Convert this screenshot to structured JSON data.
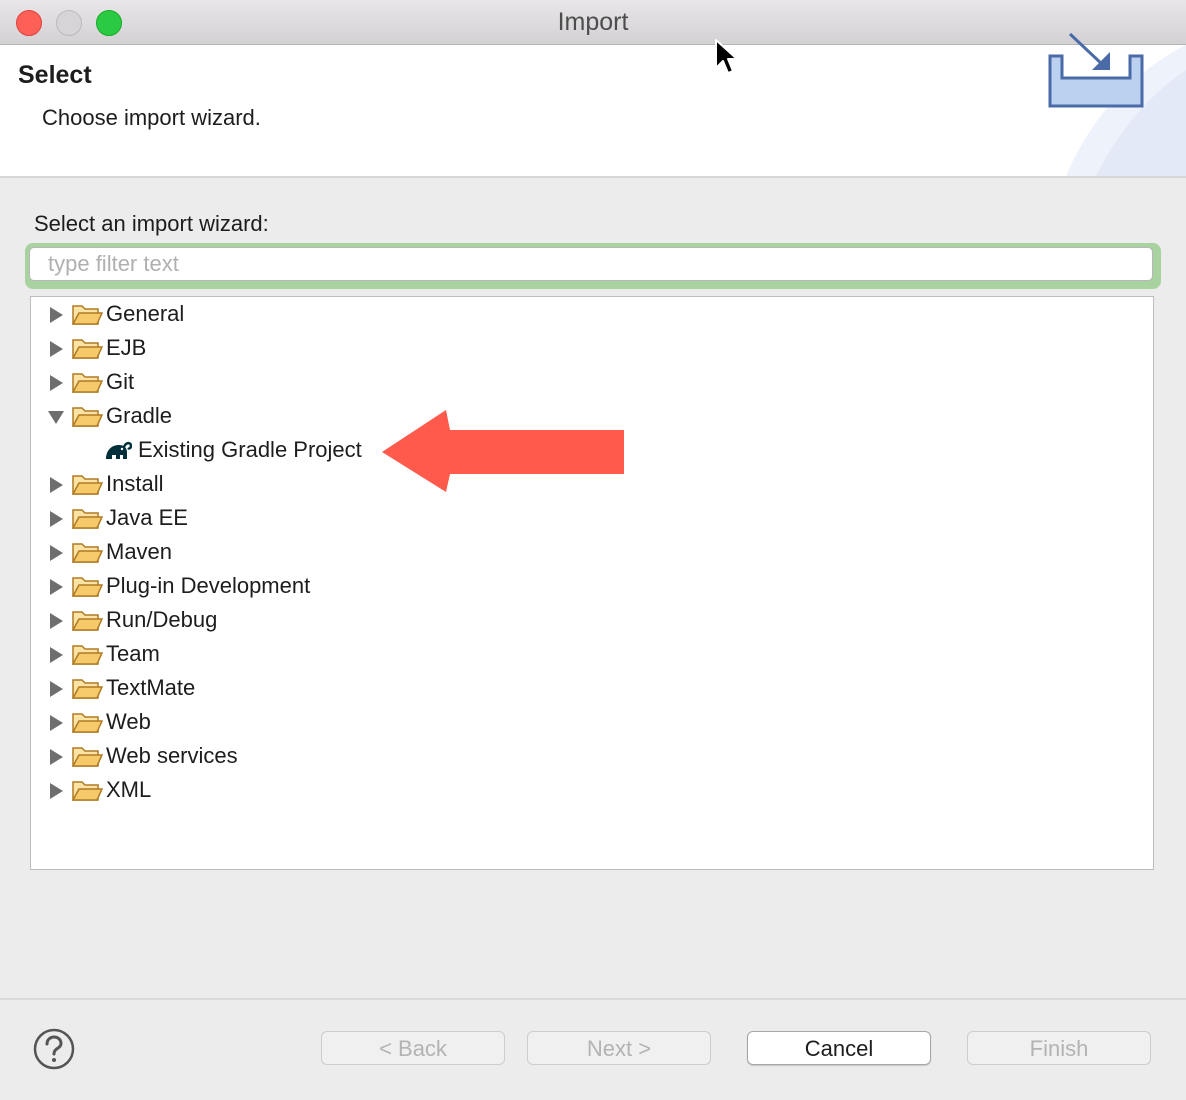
{
  "window": {
    "title": "Import"
  },
  "header": {
    "title": "Select",
    "description": "Choose import wizard."
  },
  "filter": {
    "label": "Select an import wizard:",
    "placeholder": "type filter text",
    "value": ""
  },
  "tree": {
    "items": [
      {
        "label": "General",
        "expanded": false,
        "icon": "folder-icon"
      },
      {
        "label": "EJB",
        "expanded": false,
        "icon": "folder-icon"
      },
      {
        "label": "Git",
        "expanded": false,
        "icon": "folder-icon"
      },
      {
        "label": "Gradle",
        "expanded": true,
        "icon": "folder-icon",
        "children": [
          {
            "label": "Existing Gradle Project",
            "icon": "gradle-elephant-icon"
          }
        ]
      },
      {
        "label": "Install",
        "expanded": false,
        "icon": "folder-icon"
      },
      {
        "label": "Java EE",
        "expanded": false,
        "icon": "folder-icon"
      },
      {
        "label": "Maven",
        "expanded": false,
        "icon": "folder-icon"
      },
      {
        "label": "Plug-in Development",
        "expanded": false,
        "icon": "folder-icon"
      },
      {
        "label": "Run/Debug",
        "expanded": false,
        "icon": "folder-icon"
      },
      {
        "label": "Team",
        "expanded": false,
        "icon": "folder-icon"
      },
      {
        "label": "TextMate",
        "expanded": false,
        "icon": "folder-icon"
      },
      {
        "label": "Web",
        "expanded": false,
        "icon": "folder-icon"
      },
      {
        "label": "Web services",
        "expanded": false,
        "icon": "folder-icon"
      },
      {
        "label": "XML",
        "expanded": false,
        "icon": "folder-icon"
      }
    ]
  },
  "buttons": {
    "back": {
      "label": "< Back",
      "enabled": false
    },
    "next": {
      "label": "Next >",
      "enabled": false
    },
    "cancel": {
      "label": "Cancel",
      "enabled": true
    },
    "finish": {
      "label": "Finish",
      "enabled": false
    }
  },
  "colors": {
    "close": "#fe5f57",
    "maximize": "#2acb42",
    "arrow": "#ff5a4c",
    "folder": "#f6c96b",
    "filter_focus": "#a8d2a0",
    "gradle_icon": "#02303a"
  }
}
